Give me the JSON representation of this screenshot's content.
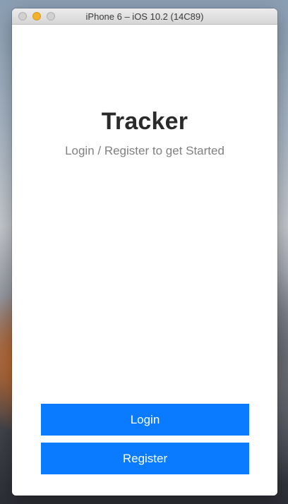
{
  "window": {
    "title": "iPhone 6 – iOS 10.2 (14C89)"
  },
  "app": {
    "title": "Tracker",
    "subtitle": "Login / Register to get Started"
  },
  "actions": {
    "login_label": "Login",
    "register_label": "Register"
  },
  "colors": {
    "button_background": "#0a7afe",
    "button_text": "#ffffff",
    "title_text": "#2a2a2a",
    "subtitle_text": "#808080"
  },
  "icons": {
    "close": "close-traffic-light-icon",
    "minimize": "minimize-traffic-light-icon",
    "zoom": "zoom-traffic-light-icon"
  }
}
